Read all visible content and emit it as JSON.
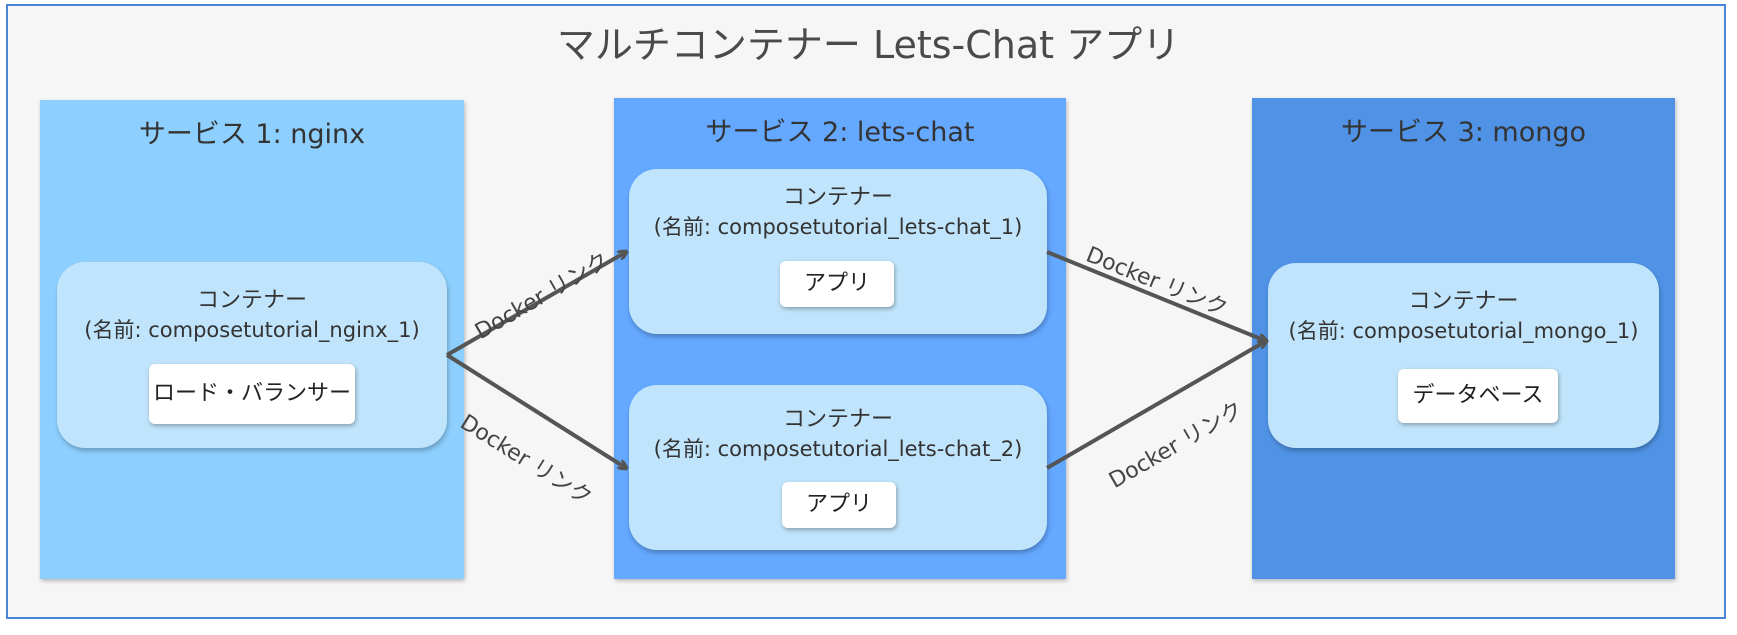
{
  "title": "マルチコンテナー Lets-Chat アプリ",
  "services": [
    {
      "title": "サービス 1: nginx"
    },
    {
      "title": "サービス 2: lets-chat"
    },
    {
      "title": "サービス 3: mongo"
    }
  ],
  "containers": {
    "label": "コンテナー",
    "nginx": {
      "name": "(名前: composetutorial_nginx_1)",
      "content": "ロード・バランサー"
    },
    "chat1": {
      "name": "(名前: composetutorial_lets-chat_1)",
      "content": "アプリ"
    },
    "chat2": {
      "name": "(名前: composetutorial_lets-chat_2)",
      "content": "アプリ"
    },
    "mongo": {
      "name": "(名前: composetutorial_mongo_1)",
      "content": "データベース"
    }
  },
  "link_label": "Docker リンク",
  "colors": {
    "frame_border": "#4a86d8",
    "service1": "#8dd0ff",
    "service2": "#64a8ff",
    "service3": "#5093e6",
    "container": "#c0e4fb",
    "arrow": "#555555"
  }
}
